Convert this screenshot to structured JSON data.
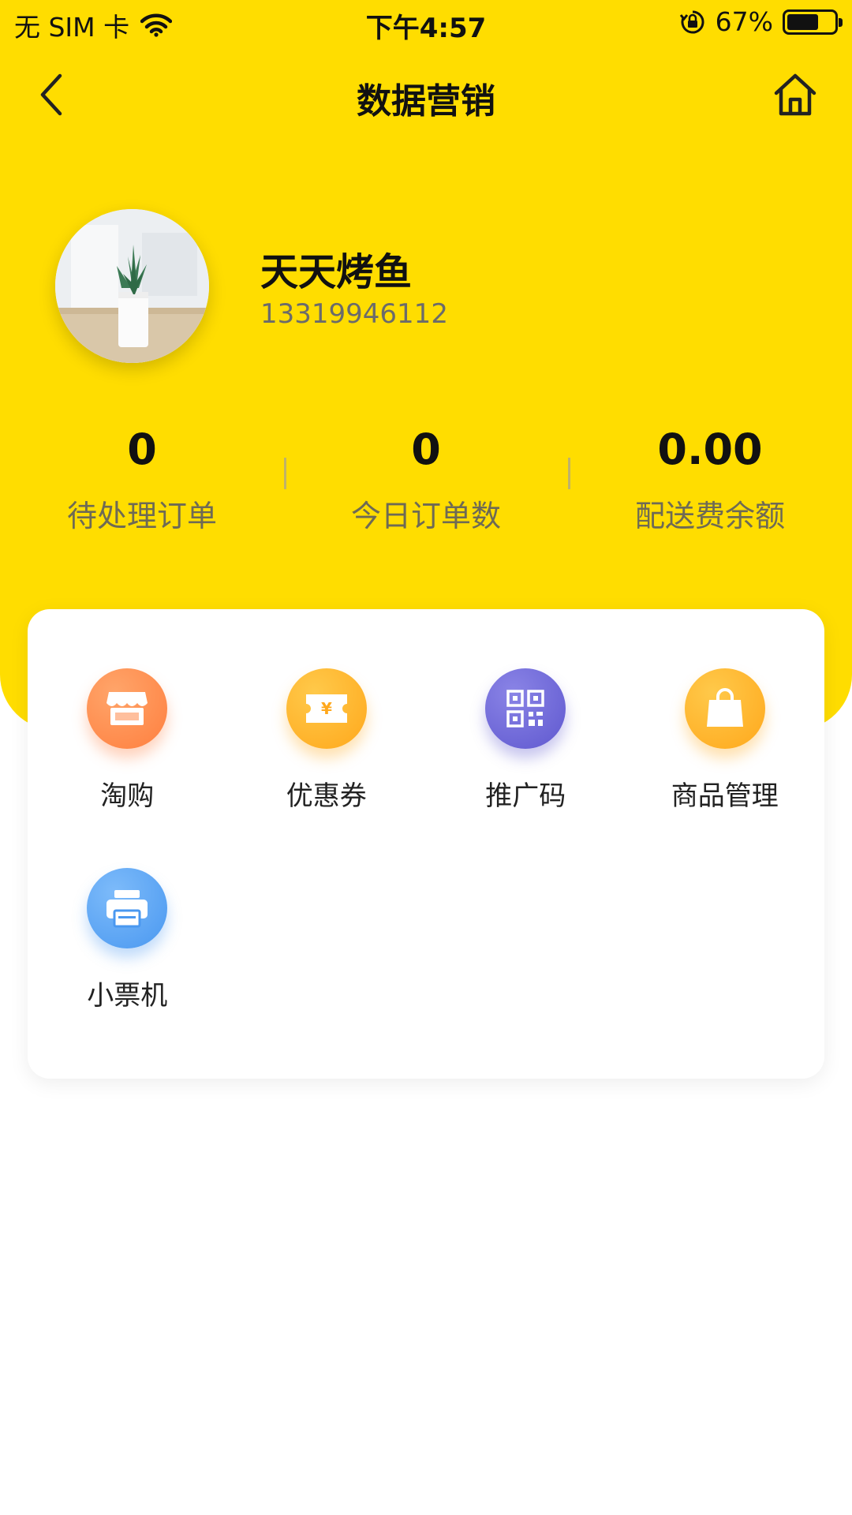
{
  "status_bar": {
    "carrier": "无 SIM 卡",
    "time": "下午4:57",
    "battery_percent": "67%",
    "battery_level": 0.67,
    "icons": [
      "wifi-icon",
      "orientation-lock-icon",
      "battery-icon"
    ]
  },
  "nav": {
    "title": "数据营销",
    "back_icon": "chevron-left-icon",
    "home_icon": "home-icon"
  },
  "profile": {
    "name": "天天烤鱼",
    "phone": "13319946112",
    "avatar": "plant-photo-avatar"
  },
  "stats": [
    {
      "value": "0",
      "label": "待处理订单"
    },
    {
      "value": "0",
      "label": "今日订单数"
    },
    {
      "value": "0.00",
      "label": "配送费余额"
    }
  ],
  "features": [
    {
      "label": "淘购",
      "icon": "shop-icon",
      "color": "#FF8A4C"
    },
    {
      "label": "优惠券",
      "icon": "coupon-icon",
      "color": "#FFB020"
    },
    {
      "label": "推广码",
      "icon": "qr-code-icon",
      "color": "#6E68D8"
    },
    {
      "label": "商品管理",
      "icon": "shopping-bag-icon",
      "color": "#FFB020"
    },
    {
      "label": "小票机",
      "icon": "printer-icon",
      "color": "#58A6F5"
    }
  ],
  "colors": {
    "header_bg": "#FFDD00",
    "page_bg": "#FFFFFF"
  }
}
